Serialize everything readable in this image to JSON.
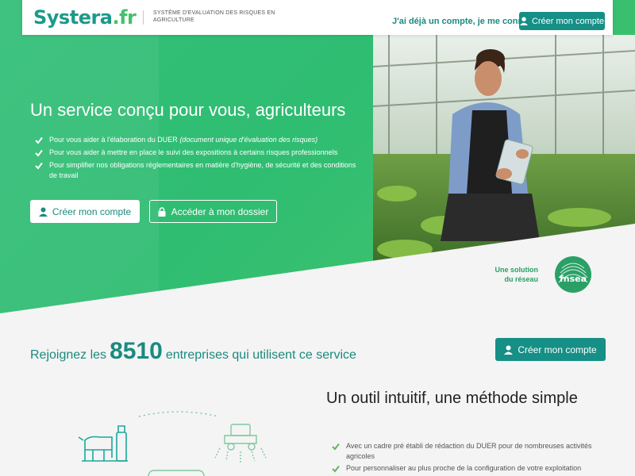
{
  "header": {
    "logo_main": "Systera",
    "logo_tld": ".fr",
    "tagline": "SYSTÈME D'EVALUATION DES RISQUES EN AGRICULTURE",
    "login_link": "J'ai déjà un compte, je me connecte",
    "create_button": "Créer mon compte"
  },
  "hero": {
    "title": "Un service conçu pour vous, agriculteurs",
    "bullets": [
      {
        "text": "Pour vous aider à l'élaboration du DUER ",
        "em": "(document unique d'évaluation des risques)"
      },
      {
        "text": "Pour vous aider à mettre en place le suivi des expositions à certains risques professionnels",
        "em": ""
      },
      {
        "text": "Pour simplifier nos obligations réglementaires en matière d'hygiène, de sécurité et des conditions de travail",
        "em": ""
      }
    ],
    "create_button": "Créer mon compte",
    "dossier_button": "Accéder à mon dossier",
    "network_text_1": "Une solution",
    "network_text_2": "du réseau",
    "network_logo": "fnsea"
  },
  "join": {
    "prefix": "Rejoignez les",
    "count": "8510",
    "suffix": "entreprises qui utilisent ce service",
    "button": "Créer mon compte"
  },
  "tool": {
    "title": "Un outil intuitif, une méthode simple",
    "bullets": [
      "Avec un cadre pré établi de rédaction du DUER pour de nombreuses activités agricoles",
      "Pour personnaliser au plus proche de la configuration de votre exploitation"
    ]
  },
  "colors": {
    "brand_teal": "#168f86",
    "brand_green": "#33bf78",
    "check_green": "#5cb85c"
  }
}
